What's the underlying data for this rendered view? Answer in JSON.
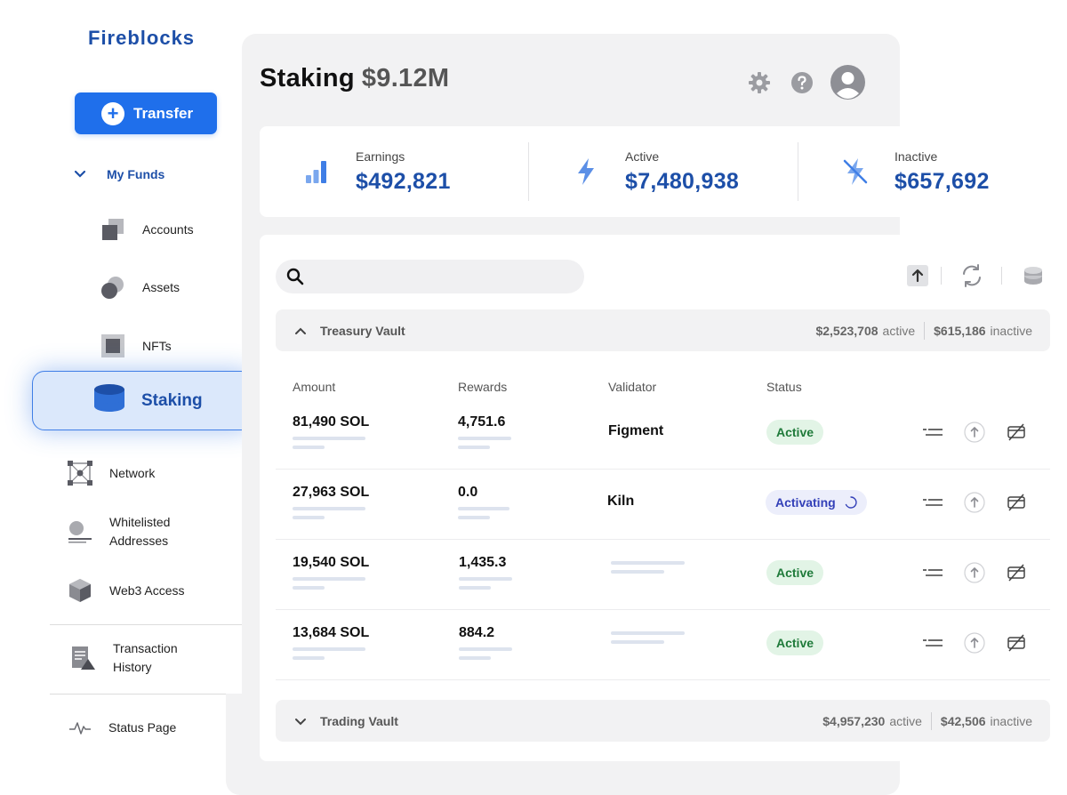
{
  "brand": "Fireblocks",
  "transfer_button": "Transfer",
  "sidebar": {
    "group_label": "My Funds",
    "items": [
      {
        "label": "Accounts"
      },
      {
        "label": "Assets"
      },
      {
        "label": "NFTs"
      },
      {
        "label": "Staking"
      },
      {
        "label": "Network"
      },
      {
        "label": "Whitelisted",
        "label2": "Addresses"
      },
      {
        "label": "Web3 Access"
      },
      {
        "label": "Transaction",
        "label2": "History"
      },
      {
        "label": "Status Page"
      }
    ]
  },
  "header": {
    "title": "Staking",
    "total": "$9.12M"
  },
  "stats": [
    {
      "label": "Earnings",
      "value": "$492,821"
    },
    {
      "label": "Active",
      "value": "$7,480,938"
    },
    {
      "label": "Inactive",
      "value": "$657,692"
    }
  ],
  "search": {
    "placeholder": ""
  },
  "vaults": [
    {
      "name": "Treasury Vault",
      "active": "$2,523,708",
      "active_word": "active",
      "inactive": "$615,186",
      "inactive_word": "inactive"
    },
    {
      "name": "Trading Vault",
      "active": "$4,957,230",
      "active_word": "active",
      "inactive": "$42,506",
      "inactive_word": "inactive"
    }
  ],
  "table": {
    "columns": [
      "Amount",
      "Rewards",
      "Validator",
      "Status"
    ],
    "rows": [
      {
        "amount": "81,490 SOL",
        "rewards": "4,751.6",
        "validator": "Figment",
        "status": "Active"
      },
      {
        "amount": "27,963 SOL",
        "rewards": "0.0",
        "validator": "Kiln",
        "status": "Activating"
      },
      {
        "amount": "19,540 SOL",
        "rewards": "1,435.3",
        "validator": "",
        "status": "Active"
      },
      {
        "amount": "13,684 SOL",
        "rewards": "884.2",
        "validator": "",
        "status": "Active"
      }
    ]
  },
  "colors": {
    "accent": "#1f6feb",
    "brand": "#1d4fa8",
    "active_pill": "#e2f4e6",
    "activating_pill": "#eceefb"
  },
  "icons": [
    "plus-icon",
    "chevron-down-icon",
    "accounts-icon",
    "assets-icon",
    "nfts-icon",
    "staking-icon",
    "network-icon",
    "whitelist-icon",
    "web3-icon",
    "history-icon",
    "status-icon",
    "gear-icon",
    "help-icon",
    "avatar-icon",
    "bar-chart-icon",
    "bolt-icon",
    "bolt-off-icon",
    "search-icon",
    "upload-icon",
    "refresh-icon",
    "database-icon",
    "chevron-up-icon",
    "list-icon",
    "unstake-icon",
    "withdraw-icon",
    "spinner-icon"
  ]
}
